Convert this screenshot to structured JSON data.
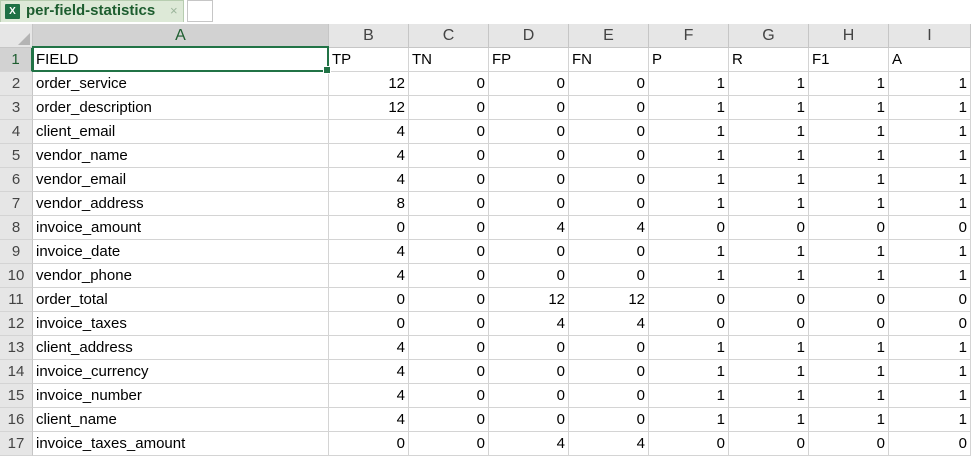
{
  "sheet_tab": {
    "icon_label": "X",
    "name": "per-field-statistics",
    "close_glyph": "×"
  },
  "columns": [
    "A",
    "B",
    "C",
    "D",
    "E",
    "F",
    "G",
    "H",
    "I"
  ],
  "header_row": [
    "FIELD",
    "TP",
    "TN",
    "FP",
    "FN",
    "P",
    "R",
    "F1",
    "A"
  ],
  "rows": [
    [
      "order_service",
      "12",
      "0",
      "0",
      "0",
      "1",
      "1",
      "1",
      "1"
    ],
    [
      "order_description",
      "12",
      "0",
      "0",
      "0",
      "1",
      "1",
      "1",
      "1"
    ],
    [
      "client_email",
      "4",
      "0",
      "0",
      "0",
      "1",
      "1",
      "1",
      "1"
    ],
    [
      "vendor_name",
      "4",
      "0",
      "0",
      "0",
      "1",
      "1",
      "1",
      "1"
    ],
    [
      "vendor_email",
      "4",
      "0",
      "0",
      "0",
      "1",
      "1",
      "1",
      "1"
    ],
    [
      "vendor_address",
      "8",
      "0",
      "0",
      "0",
      "1",
      "1",
      "1",
      "1"
    ],
    [
      "invoice_amount",
      "0",
      "0",
      "4",
      "4",
      "0",
      "0",
      "0",
      "0"
    ],
    [
      "invoice_date",
      "4",
      "0",
      "0",
      "0",
      "1",
      "1",
      "1",
      "1"
    ],
    [
      "vendor_phone",
      "4",
      "0",
      "0",
      "0",
      "1",
      "1",
      "1",
      "1"
    ],
    [
      "order_total",
      "0",
      "0",
      "12",
      "12",
      "0",
      "0",
      "0",
      "0"
    ],
    [
      "invoice_taxes",
      "0",
      "0",
      "4",
      "4",
      "0",
      "0",
      "0",
      "0"
    ],
    [
      "client_address",
      "4",
      "0",
      "0",
      "0",
      "1",
      "1",
      "1",
      "1"
    ],
    [
      "invoice_currency",
      "4",
      "0",
      "0",
      "0",
      "1",
      "1",
      "1",
      "1"
    ],
    [
      "invoice_number",
      "4",
      "0",
      "0",
      "0",
      "1",
      "1",
      "1",
      "1"
    ],
    [
      "client_name",
      "4",
      "0",
      "0",
      "0",
      "1",
      "1",
      "1",
      "1"
    ],
    [
      "invoice_taxes_amount",
      "0",
      "0",
      "4",
      "4",
      "0",
      "0",
      "0",
      "0"
    ]
  ],
  "row_numbers": [
    "1",
    "2",
    "3",
    "4",
    "5",
    "6",
    "7",
    "8",
    "9",
    "10",
    "11",
    "12",
    "13",
    "14",
    "15",
    "16",
    "17"
  ],
  "active_cell": "A1",
  "colors": {
    "accent": "#217346",
    "tab_bg": "#dde9d7",
    "header_bg": "#e6e6e6"
  }
}
